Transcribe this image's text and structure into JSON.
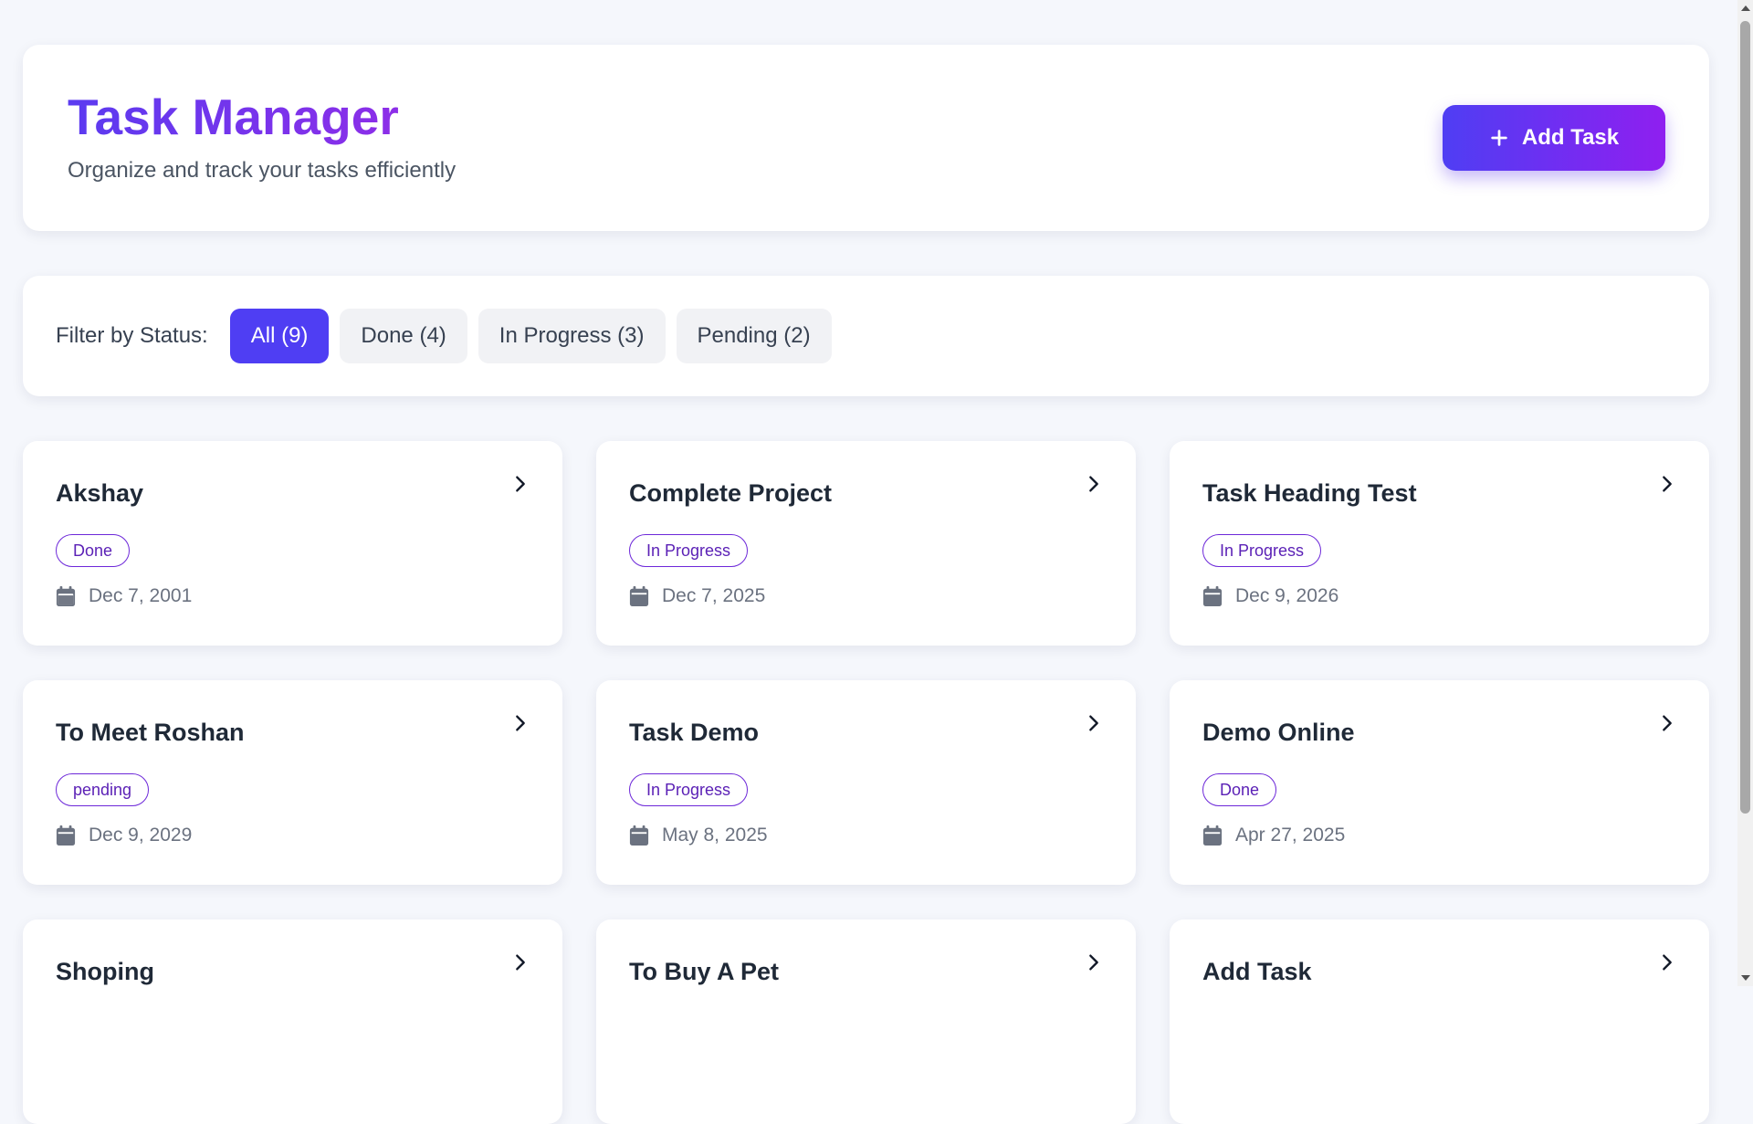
{
  "header": {
    "title": "Task Manager",
    "subtitle": "Organize and track your tasks efficiently",
    "add_button_label": "Add Task"
  },
  "filters": {
    "label": "Filter by Status:",
    "options": [
      {
        "label": "All (9)",
        "active": true
      },
      {
        "label": "Done (4)",
        "active": false
      },
      {
        "label": "In Progress (3)",
        "active": false
      },
      {
        "label": "Pending (2)",
        "active": false
      }
    ]
  },
  "tasks": [
    {
      "title": "Akshay",
      "status": "Done",
      "date": "Dec 7, 2001"
    },
    {
      "title": "Complete Project",
      "status": "In Progress",
      "date": "Dec 7, 2025"
    },
    {
      "title": "Task Heading Test",
      "status": "In Progress",
      "date": "Dec 9, 2026"
    },
    {
      "title": "To Meet Roshan",
      "status": "pending",
      "date": "Dec 9, 2029"
    },
    {
      "title": "Task Demo",
      "status": "In Progress",
      "date": "May 8, 2025"
    },
    {
      "title": "Demo Online",
      "status": "Done",
      "date": "Apr 27, 2025"
    },
    {
      "title": "Shoping",
      "status": "",
      "date": ""
    },
    {
      "title": "To Buy A Pet",
      "status": "",
      "date": ""
    },
    {
      "title": "Add Task",
      "status": "",
      "date": ""
    }
  ],
  "colors": {
    "accent": "#4f3ef3",
    "accent_end": "#8f1ff0",
    "badge_border": "#6d28d9"
  },
  "icons": {
    "add": "plus-icon",
    "open": "chevron-right-icon",
    "date": "calendar-icon"
  }
}
